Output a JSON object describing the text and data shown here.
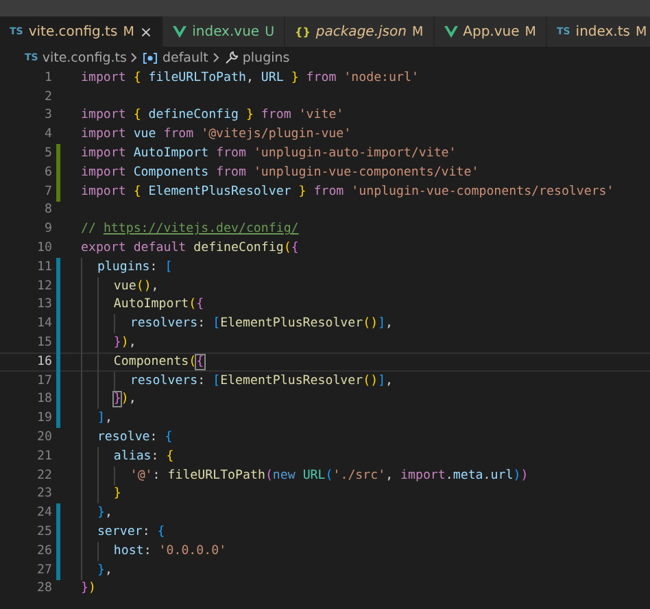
{
  "tabs": [
    {
      "kind": "ts",
      "icon_text": "TS",
      "name": "vite.config.ts",
      "status": "M",
      "selected": true,
      "preview": false,
      "close": "×"
    },
    {
      "kind": "vue",
      "name": "index.vue",
      "status": "U",
      "selected": false,
      "preview": false
    },
    {
      "kind": "json",
      "icon_text": "{}",
      "name": "package.json",
      "status": "M",
      "selected": false,
      "preview": true
    },
    {
      "kind": "vue",
      "name": "App.vue",
      "status": "M",
      "selected": false,
      "preview": false
    },
    {
      "kind": "ts",
      "icon_text": "TS",
      "name": "index.ts",
      "status": "M",
      "selected": false,
      "preview": false
    }
  ],
  "breadcrumb": [
    {
      "kind": "ts",
      "icon_text": "TS",
      "label": "vite.config.ts"
    },
    {
      "kind": "module",
      "label": "default"
    },
    {
      "kind": "wrench",
      "label": "plugins"
    }
  ],
  "lines": [
    {
      "number": "1",
      "current": false,
      "tokens": [
        {
          "kind": "kw",
          "text": "import "
        },
        {
          "kind": "b1",
          "text": "{"
        },
        {
          "kind": "var",
          "text": " fileURLToPath"
        },
        {
          "kind": "p",
          "text": ", "
        },
        {
          "kind": "var",
          "text": "URL "
        },
        {
          "kind": "b1",
          "text": "}"
        },
        {
          "kind": "kw",
          "text": " from "
        },
        {
          "kind": "str",
          "text": "'node:url'"
        }
      ]
    },
    {
      "number": "2",
      "current": false
    },
    {
      "number": "3",
      "current": false,
      "tokens": [
        {
          "kind": "kw",
          "text": "import "
        },
        {
          "kind": "b1",
          "text": "{"
        },
        {
          "kind": "var",
          "text": " defineConfig "
        },
        {
          "kind": "b1",
          "text": "}"
        },
        {
          "kind": "kw",
          "text": " from "
        },
        {
          "kind": "str",
          "text": "'vite'"
        }
      ]
    },
    {
      "number": "4",
      "current": false,
      "tokens": [
        {
          "kind": "kw",
          "text": "import "
        },
        {
          "kind": "var",
          "text": "vue "
        },
        {
          "kind": "kw",
          "text": "from "
        },
        {
          "kind": "str",
          "text": "'@vitejs/plugin-vue'"
        }
      ]
    },
    {
      "number": "5",
      "color": "#587c0c",
      "current": false,
      "tokens": [
        {
          "kind": "kw",
          "text": "import "
        },
        {
          "kind": "var",
          "text": "AutoImport "
        },
        {
          "kind": "kw",
          "text": "from "
        },
        {
          "kind": "str",
          "text": "'unplugin-auto-import/vite'"
        }
      ]
    },
    {
      "number": "6",
      "color": "#587c0c",
      "current": false,
      "tokens": [
        {
          "kind": "kw",
          "text": "import "
        },
        {
          "kind": "var",
          "text": "Components "
        },
        {
          "kind": "kw",
          "text": "from "
        },
        {
          "kind": "str",
          "text": "'unplugin-vue-components/vite'"
        }
      ]
    },
    {
      "number": "7",
      "color": "#587c0c",
      "current": false,
      "tokens": [
        {
          "kind": "kw",
          "text": "import "
        },
        {
          "kind": "b1",
          "text": "{"
        },
        {
          "kind": "var",
          "text": " ElementPlusResolver "
        },
        {
          "kind": "b1",
          "text": "}"
        },
        {
          "kind": "kw",
          "text": " from "
        },
        {
          "kind": "str",
          "text": "'unplugin-vue-components/resolvers'"
        }
      ]
    },
    {
      "number": "8",
      "current": false
    },
    {
      "number": "9",
      "current": false,
      "tokens": [
        {
          "kind": "cm",
          "text": "// "
        },
        {
          "kind": "link",
          "text": "https://vitejs.dev/config/"
        }
      ]
    },
    {
      "number": "10",
      "current": false,
      "tokens": [
        {
          "kind": "kw",
          "text": "export default "
        },
        {
          "kind": "fn",
          "text": "defineConfig"
        },
        {
          "kind": "b1",
          "text": "("
        },
        {
          "kind": "b2",
          "text": "{"
        }
      ]
    },
    {
      "number": "11",
      "color": "#0c7d9d",
      "current": false,
      "tokens": [
        {
          "kind": "var",
          "text": "  plugins"
        },
        {
          "kind": "p",
          "text": ": "
        },
        {
          "kind": "b3",
          "text": "["
        }
      ]
    },
    {
      "number": "12",
      "color": "#0c7d9d",
      "current": false,
      "tokens": [
        {
          "kind": "fn",
          "text": "    vue"
        },
        {
          "kind": "b1",
          "text": "()"
        },
        {
          "kind": "p",
          "text": ","
        }
      ]
    },
    {
      "number": "13",
      "color": "#0c7d9d",
      "current": false,
      "tokens": [
        {
          "kind": "fn",
          "text": "    AutoImport"
        },
        {
          "kind": "b1",
          "text": "("
        },
        {
          "kind": "b2",
          "text": "{"
        }
      ]
    },
    {
      "number": "14",
      "color": "#0c7d9d",
      "current": false,
      "tokens": [
        {
          "kind": "var",
          "text": "      resolvers"
        },
        {
          "kind": "p",
          "text": ": "
        },
        {
          "kind": "b3",
          "text": "["
        },
        {
          "kind": "fn",
          "text": "ElementPlusResolver"
        },
        {
          "kind": "b1",
          "text": "()"
        },
        {
          "kind": "b3",
          "text": "]"
        },
        {
          "kind": "p",
          "text": ","
        }
      ]
    },
    {
      "number": "15",
      "color": "#0c7d9d",
      "current": false,
      "tokens": [
        {
          "kind": "b2",
          "text": "    }"
        },
        {
          "kind": "b1",
          "text": ")"
        },
        {
          "kind": "p",
          "text": ","
        }
      ]
    },
    {
      "number": "16",
      "color": "#0c7d9d",
      "current": true,
      "tokens": [
        {
          "kind": "fn",
          "text": "    Components"
        },
        {
          "kind": "b1",
          "text": "("
        },
        {
          "kind": "b2m",
          "text": "{"
        }
      ]
    },
    {
      "number": "17",
      "color": "#0c7d9d",
      "current": false,
      "tokens": [
        {
          "kind": "var",
          "text": "      resolvers"
        },
        {
          "kind": "p",
          "text": ": "
        },
        {
          "kind": "b3",
          "text": "["
        },
        {
          "kind": "fn",
          "text": "ElementPlusResolver"
        },
        {
          "kind": "b1",
          "text": "()"
        },
        {
          "kind": "b3",
          "text": "]"
        },
        {
          "kind": "p",
          "text": ","
        }
      ]
    },
    {
      "number": "18",
      "color": "#0c7d9d",
      "current": false,
      "tokens": [
        {
          "kind": "b2m",
          "text": "    }"
        },
        {
          "kind": "b1",
          "text": ")"
        },
        {
          "kind": "p",
          "text": ","
        }
      ]
    },
    {
      "number": "19",
      "color": "#0c7d9d",
      "current": false,
      "tokens": [
        {
          "kind": "b3",
          "text": "  ]"
        },
        {
          "kind": "p",
          "text": ","
        }
      ]
    },
    {
      "number": "20",
      "current": false,
      "tokens": [
        {
          "kind": "var",
          "text": "  resolve"
        },
        {
          "kind": "p",
          "text": ": "
        },
        {
          "kind": "b3",
          "text": "{"
        }
      ]
    },
    {
      "number": "21",
      "current": false,
      "tokens": [
        {
          "kind": "var",
          "text": "    alias"
        },
        {
          "kind": "p",
          "text": ": "
        },
        {
          "kind": "b1",
          "text": "{"
        }
      ]
    },
    {
      "number": "22",
      "current": false,
      "tokens": [
        {
          "kind": "str",
          "text": "      '@'"
        },
        {
          "kind": "p",
          "text": ": "
        },
        {
          "kind": "fn",
          "text": "fileURLToPath"
        },
        {
          "kind": "b2",
          "text": "("
        },
        {
          "kind": "kw2",
          "text": "new "
        },
        {
          "kind": "cls",
          "text": "URL"
        },
        {
          "kind": "b3",
          "text": "("
        },
        {
          "kind": "str",
          "text": "'./src'"
        },
        {
          "kind": "p",
          "text": ", "
        },
        {
          "kind": "kw",
          "text": "import"
        },
        {
          "kind": "p",
          "text": "."
        },
        {
          "kind": "var",
          "text": "meta"
        },
        {
          "kind": "p",
          "text": "."
        },
        {
          "kind": "var",
          "text": "url"
        },
        {
          "kind": "b3",
          "text": ")"
        },
        {
          "kind": "b2",
          "text": ")"
        }
      ]
    },
    {
      "number": "23",
      "current": false,
      "tokens": [
        {
          "kind": "b1",
          "text": "    }"
        }
      ]
    },
    {
      "number": "24",
      "color": "#0c7d9d",
      "current": false,
      "tokens": [
        {
          "kind": "b3",
          "text": "  }"
        },
        {
          "kind": "p",
          "text": ","
        }
      ]
    },
    {
      "number": "25",
      "color": "#0c7d9d",
      "current": false,
      "tokens": [
        {
          "kind": "var",
          "text": "  server"
        },
        {
          "kind": "p",
          "text": ": "
        },
        {
          "kind": "b3",
          "text": "{"
        }
      ]
    },
    {
      "number": "26",
      "color": "#0c7d9d",
      "current": false,
      "tokens": [
        {
          "kind": "var",
          "text": "    host"
        },
        {
          "kind": "p",
          "text": ": "
        },
        {
          "kind": "str",
          "text": "'0.0.0.0'"
        }
      ]
    },
    {
      "number": "27",
      "color": "#0c7d9d",
      "current": false,
      "tokens": [
        {
          "kind": "b3",
          "text": "  }"
        },
        {
          "kind": "p",
          "text": ","
        }
      ]
    },
    {
      "number": "28",
      "current": false,
      "tokens": [
        {
          "kind": "b2",
          "text": "}"
        },
        {
          "kind": "b1",
          "text": ")"
        }
      ]
    }
  ]
}
